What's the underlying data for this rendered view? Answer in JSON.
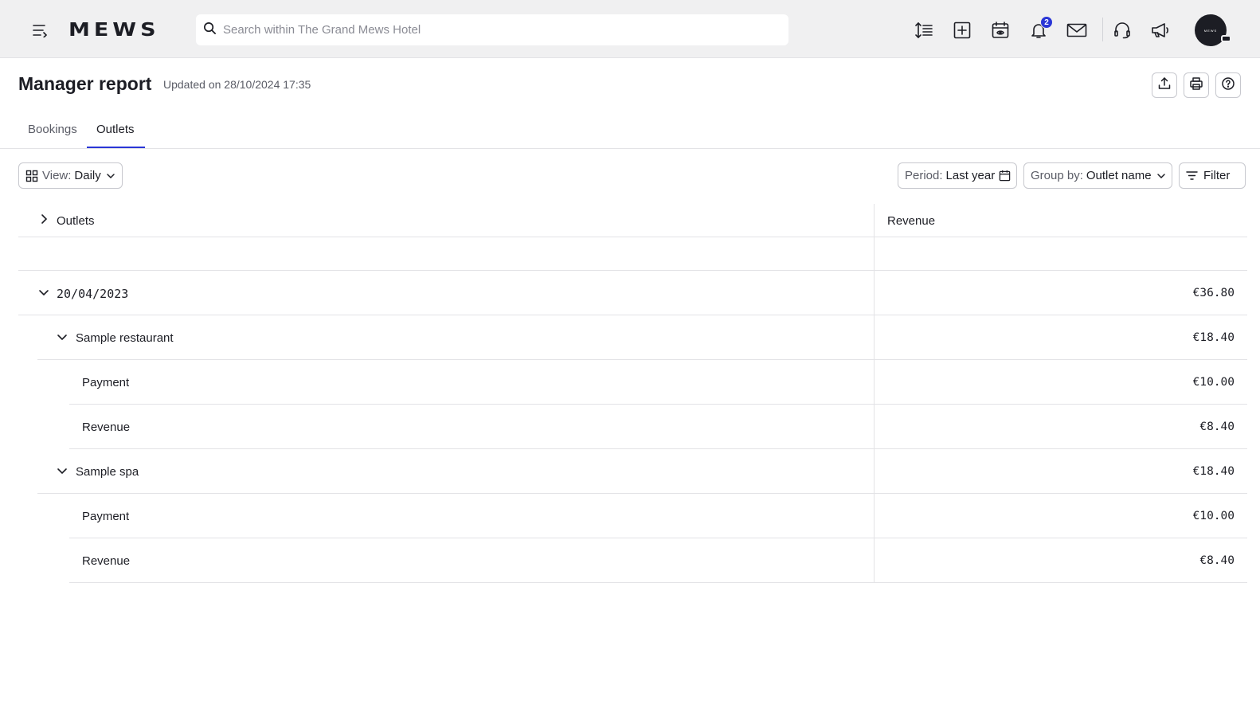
{
  "topbar": {
    "logo": "MEWS",
    "search_placeholder": "Search within The Grand Mews Hotel",
    "notification_count": "2",
    "avatar_text": "MEWS",
    "icons": [
      "menu-icon",
      "line-height-icon",
      "add-square-icon",
      "calendar-eye-icon",
      "bell-icon",
      "mail-icon",
      "headset-icon",
      "megaphone-icon"
    ]
  },
  "header": {
    "title": "Manager report",
    "updated": "Updated on 28/10/2024 17:35",
    "actions": [
      "export-icon",
      "print-icon",
      "help-icon"
    ]
  },
  "tabs": [
    {
      "label": "Bookings",
      "active": false
    },
    {
      "label": "Outlets",
      "active": true
    }
  ],
  "toolbar": {
    "view_label": "View:",
    "view_value": "Daily",
    "period_label": "Period:",
    "period_value": "Last year",
    "group_label": "Group by:",
    "group_value": "Outlet name",
    "filter_label": "Filter"
  },
  "table": {
    "columns": [
      "Outlets",
      "Revenue"
    ],
    "rows": [
      {
        "level": 0,
        "label": "20/04/2023",
        "value": "€36.80",
        "expanded": true
      },
      {
        "level": 1,
        "label": "Sample restaurant",
        "value": "€18.40",
        "expanded": true
      },
      {
        "level": 2,
        "label": "Payment",
        "value": "€10.00"
      },
      {
        "level": 2,
        "label": "Revenue",
        "value": "€8.40"
      },
      {
        "level": 1,
        "label": "Sample spa",
        "value": "€18.40",
        "expanded": true
      },
      {
        "level": 2,
        "label": "Payment",
        "value": "€10.00"
      },
      {
        "level": 2,
        "label": "Revenue",
        "value": "€8.40"
      }
    ]
  },
  "colors": {
    "accent": "#2a36d6",
    "topbar_bg": "#f0f0f1",
    "text": "#1c1d24",
    "border": "#e3e3e6"
  }
}
